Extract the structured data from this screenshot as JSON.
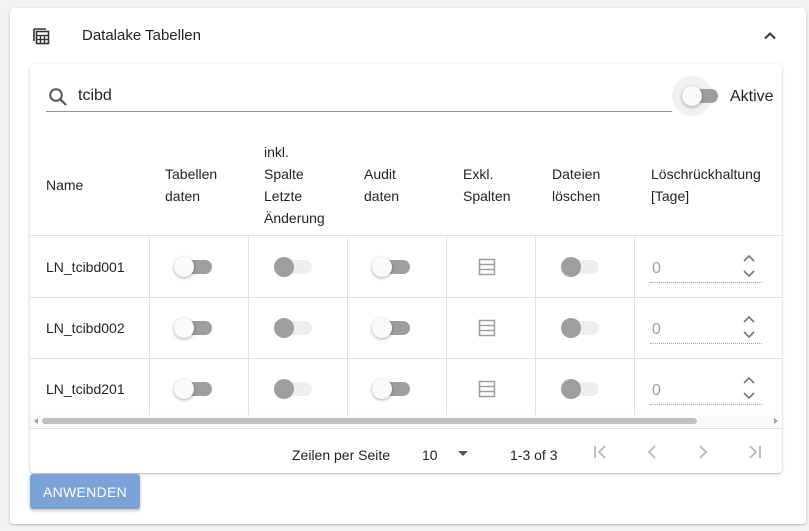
{
  "panel": {
    "title": "Datalake Tabellen",
    "icon": "table-grid-icon",
    "collapse_icon": "chevron-up-icon"
  },
  "search": {
    "value": "tcibd",
    "placeholder": "",
    "icon": "search-icon"
  },
  "active_toggle": {
    "label": "Aktive",
    "checked": false
  },
  "table": {
    "headers": {
      "name": "Name",
      "tabellen_daten": [
        "Tabellen",
        "daten"
      ],
      "spalte_letzte_aenderung": [
        "inkl.",
        "Spalte",
        "Letzte",
        "Änderung"
      ],
      "audit_daten": [
        "Audit",
        "daten"
      ],
      "exkl_spalten": [
        "Exkl.",
        "Spalten"
      ],
      "dateien_loeschen": [
        "Dateien",
        "löschen"
      ],
      "loeschrueckhaltung": [
        "Löschrückhaltung",
        "[Tage]"
      ]
    },
    "rows": [
      {
        "name": "LN_tcibd001",
        "retention": "0"
      },
      {
        "name": "LN_tcibd002",
        "retention": "0"
      },
      {
        "name": "LN_tcibd201",
        "retention": "0"
      }
    ]
  },
  "pagination": {
    "rows_per_page_label": "Zeilen per Seite",
    "rows_per_page": "10",
    "range": "1-3 of 3"
  },
  "apply_button": {
    "label": "ANWENDEN"
  },
  "colors": {
    "primary_button": "#7ba3d6",
    "background": "#f3f3f3",
    "divider": "#e0e0e0"
  }
}
